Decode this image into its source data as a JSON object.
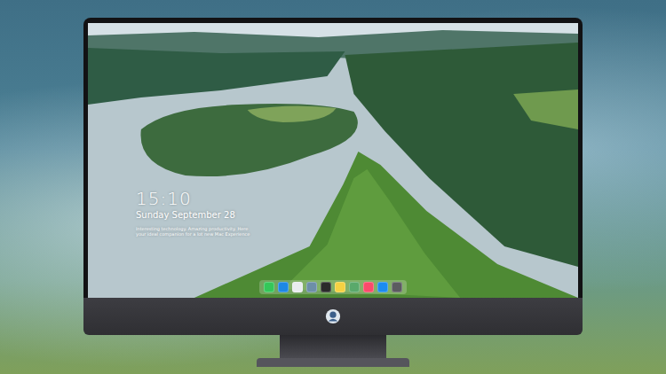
{
  "lock_screen": {
    "time": "15:10",
    "date": "Sunday September 28",
    "tagline": [
      "Interesting technology. Amazing productivity. Here",
      "your ideal companion for a lot new Mac Experience"
    ]
  },
  "dock": {
    "apps": [
      {
        "color": "#34c759"
      },
      {
        "color": "#1e88e5"
      },
      {
        "color": "#e9ecef"
      },
      {
        "color": "#6d8fa8"
      },
      {
        "color": "#2b2b2b"
      },
      {
        "color": "#f5d142"
      },
      {
        "color": "#5aa96b"
      },
      {
        "color": "#fa4a6b"
      },
      {
        "color": "#1c8cf0"
      },
      {
        "color": "#5b5b60"
      }
    ]
  }
}
